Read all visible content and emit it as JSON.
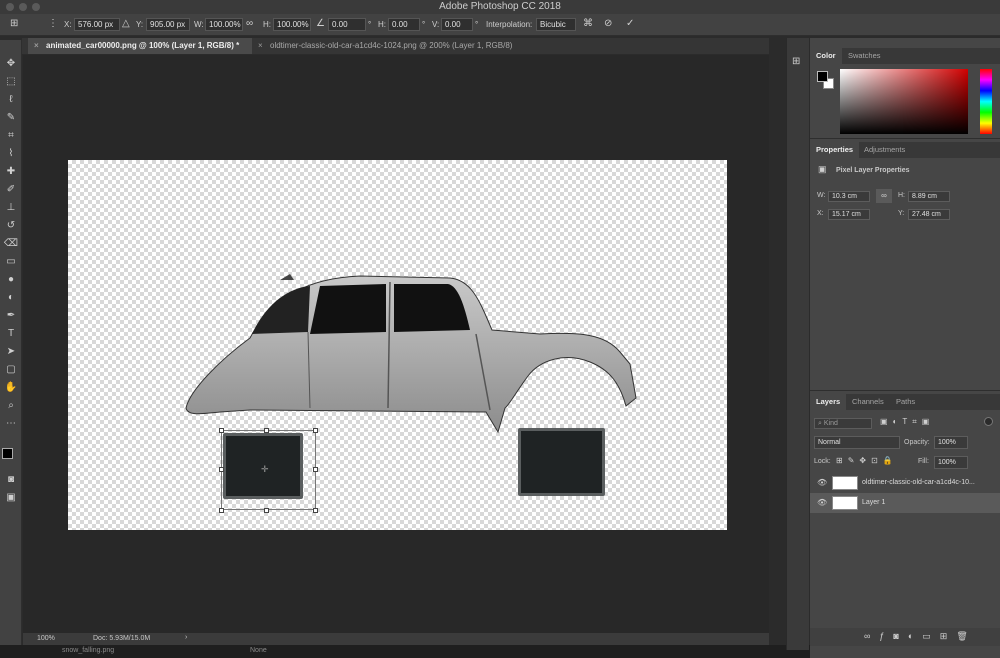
{
  "window": {
    "title": "Adobe Photoshop CC 2018"
  },
  "options_bar": {
    "x_label": "X:",
    "x_value": "576.00 px",
    "y_label": "Y:",
    "y_value": "905.00 px",
    "w_label": "W:",
    "w_value": "100.00%",
    "h_label": "H:",
    "h_value": "100.00%",
    "angle_value": "0.00",
    "angle_unit": "°",
    "hskew_label": "H:",
    "hskew_value": "0.00",
    "vskew_label": "V:",
    "vskew_value": "0.00",
    "skew_unit": "°",
    "interp_label": "Interpolation:",
    "interp_value": "Bicubic"
  },
  "tabs": [
    {
      "label": "animated_car00000.png @ 100% (Layer 1, RGB/8) *",
      "close": "×"
    },
    {
      "label": "oldtimer-classic-old-car-a1cd4c-1024.png @ 200% (Layer 1, RGB/8)",
      "close": "×"
    }
  ],
  "status": {
    "zoom": "100%",
    "doc": "Doc: 5.93M/15.0M"
  },
  "color_panel": {
    "tabs": [
      "Color",
      "Swatches"
    ]
  },
  "properties_panel": {
    "tabs": [
      "Properties",
      "Adjustments"
    ],
    "heading": "Pixel Layer Properties",
    "w_label": "W:",
    "w_value": "10.3 cm",
    "h_label": "H:",
    "h_value": "8.89 cm",
    "x_label": "X:",
    "x_value": "15.17 cm",
    "y_label": "Y:",
    "y_value": "27.48 cm"
  },
  "layers_panel": {
    "tabs": [
      "Layers",
      "Channels",
      "Paths"
    ],
    "filter_placeholder": "Kind",
    "blend_mode": "Normal",
    "opacity_label": "Opacity:",
    "opacity_value": "100%",
    "lock_label": "Lock:",
    "fill_label": "Fill:",
    "fill_value": "100%",
    "layers": [
      {
        "name": "oldtimer-classic-old-car-a1cd4c-10..."
      },
      {
        "name": "Layer 1"
      }
    ]
  },
  "bottom_strip": {
    "item1": "snow_falling.png",
    "item2": "None"
  },
  "colors": {
    "foreground": "#000000",
    "background": "#ffffff"
  }
}
